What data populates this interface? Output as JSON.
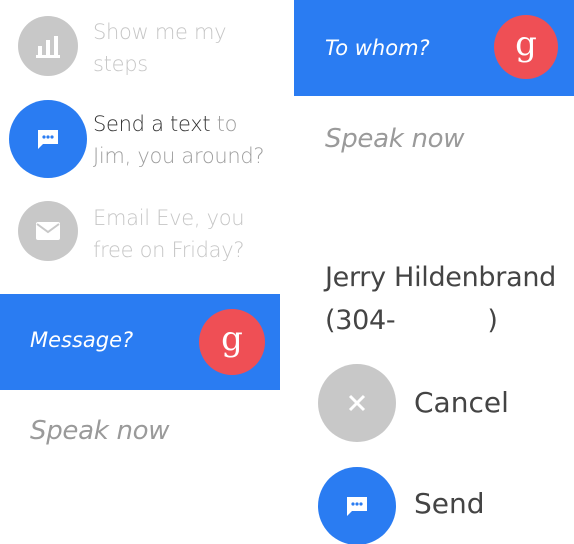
{
  "suggestions": [
    {
      "command": "Show me my",
      "rest": "steps",
      "icon": "bar-chart-icon"
    },
    {
      "command": "Send a text",
      "rest_inline": "to",
      "rest": "Jim, you around?",
      "icon": "message-icon"
    },
    {
      "command": "Email",
      "rest_inline": "Eve, you",
      "rest": "free on Friday?",
      "icon": "email-icon"
    }
  ],
  "message_screen": {
    "prompt": "Message?",
    "hint": "Speak now",
    "logo": "g"
  },
  "to_whom_screen": {
    "prompt": "To whom?",
    "hint": "Speak now",
    "logo": "g"
  },
  "confirm_screen": {
    "contact_name_partial": "Jerry Hildenbrand",
    "contact_phone": "(304-",
    "contact_phone_end": ")",
    "cancel_label": "Cancel",
    "send_label": "Send"
  },
  "colors": {
    "accent": "#2a7cf2",
    "google_red": "#ef4f55",
    "disabled": "#c8c8c8"
  }
}
